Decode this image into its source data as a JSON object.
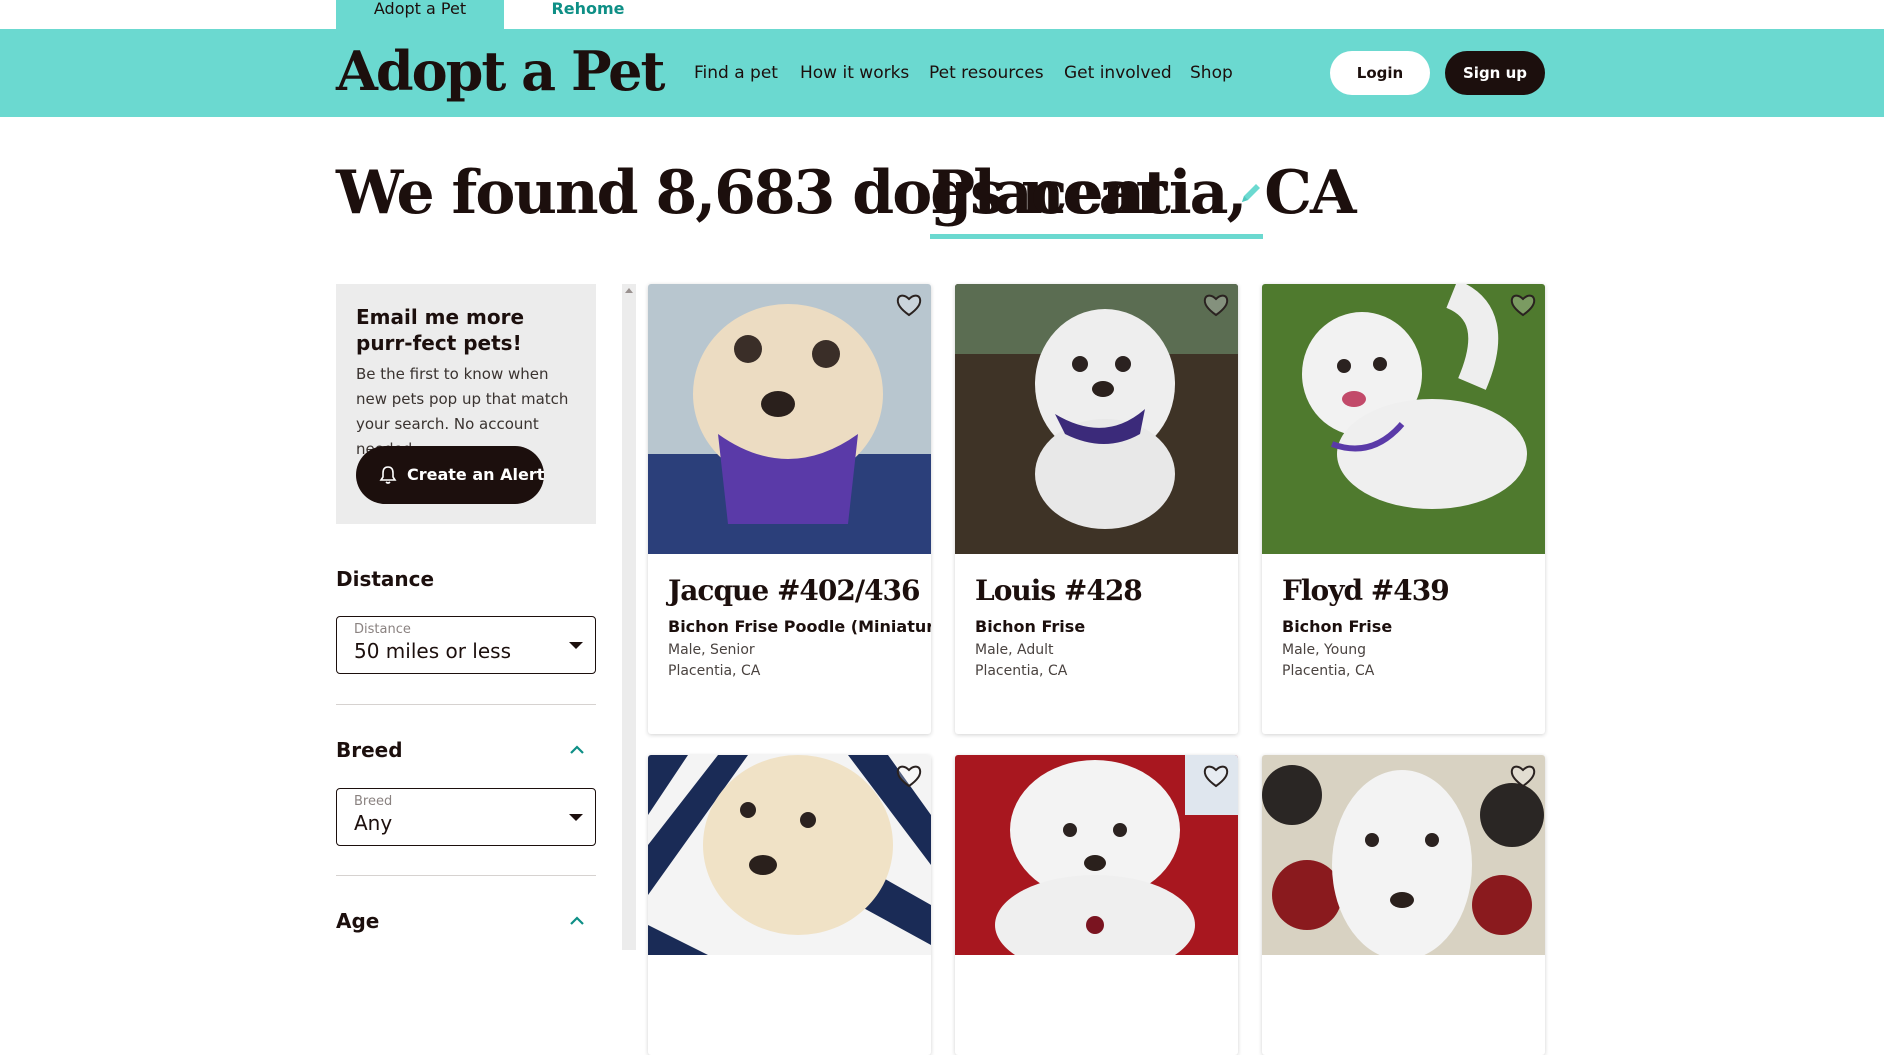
{
  "top_tabs": {
    "adopt": "Adopt a Pet",
    "rehome": "Rehome"
  },
  "header": {
    "logo": "Adopt a Pet",
    "nav": [
      "Find a pet",
      "How it works",
      "Pet resources",
      "Get involved",
      "Shop"
    ],
    "login": "Login",
    "signup": "Sign up"
  },
  "headline": {
    "prefix": "We found 8,683 dogs near",
    "location": "Placentia, CA"
  },
  "alert": {
    "title": "Email me more purr-fect pets!",
    "text": "Be the first to know when new pets pop up that match your search. No account needed.",
    "button": "Create an Alert"
  },
  "filters": {
    "distance": {
      "heading": "Distance",
      "label": "Distance",
      "value": "50 miles or less"
    },
    "breed": {
      "heading": "Breed",
      "label": "Breed",
      "value": "Any"
    },
    "age": {
      "heading": "Age"
    }
  },
  "pets": [
    {
      "name": "Jacque #402/436",
      "breed": "Bichon Frise Poodle (Miniature)",
      "info": "Male, Senior",
      "location": "Placentia, CA"
    },
    {
      "name": "Louis #428",
      "breed": "Bichon Frise",
      "info": "Male, Adult",
      "location": "Placentia, CA"
    },
    {
      "name": "Floyd #439",
      "breed": "Bichon Frise",
      "info": "Male, Young",
      "location": "Placentia, CA"
    }
  ],
  "colors": {
    "brand_teal": "#6bd9d0",
    "dark": "#1c0f0d",
    "link_teal": "#0e8f86"
  }
}
